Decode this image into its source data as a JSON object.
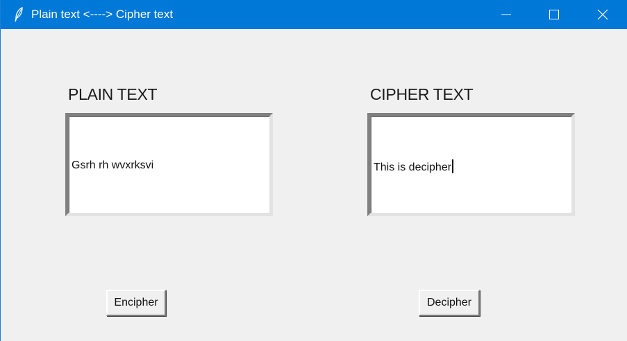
{
  "window": {
    "title": "Plain text <----> Cipher text",
    "accent_color": "#0078d7",
    "app_icon": "feather-icon",
    "controls": {
      "minimize_icon": "minimize-icon",
      "maximize_icon": "maximize-icon",
      "close_icon": "close-icon"
    }
  },
  "plain": {
    "heading": "PLAIN TEXT",
    "value": "Gsrh rh wvxrksvi"
  },
  "cipher": {
    "heading": "CIPHER TEXT",
    "value": "This is decipher"
  },
  "buttons": {
    "encipher_label": "Encipher",
    "decipher_label": "Decipher"
  }
}
